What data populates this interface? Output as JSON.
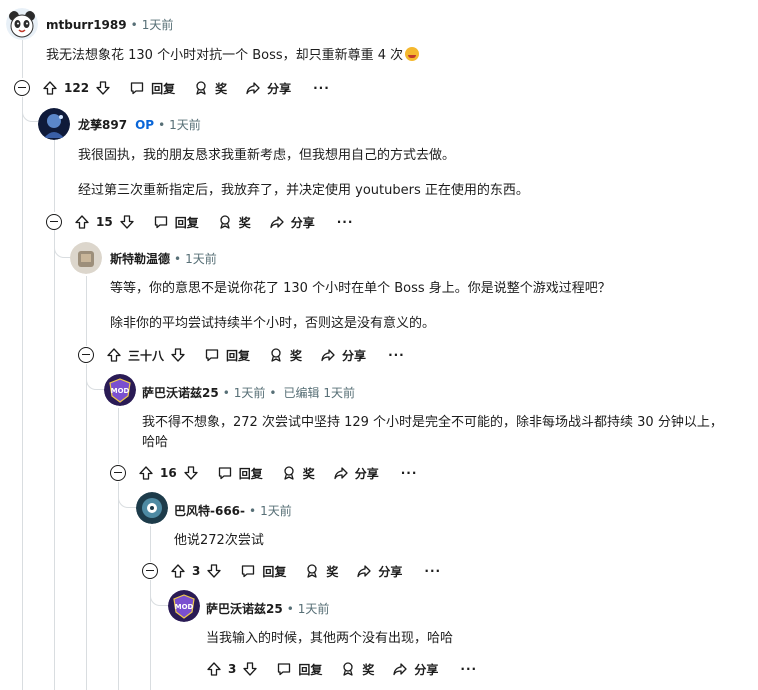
{
  "comments": [
    {
      "author": "mtburr1989",
      "op": "",
      "time": "1天前",
      "edited": "",
      "lines": [
        "我无法想象花 130 个小时对抗一个 Boss，却只重新尊重 4 次"
      ],
      "emoji": "rolling-on-floor-laughing",
      "score": "122"
    },
    {
      "author": "龙孳897",
      "op": "OP",
      "time": "1天前",
      "edited": "",
      "lines": [
        "我很固执，我的朋友恳求我重新考虑，但我想用自己的方式去做。",
        "经过第三次重新指定后，我放弃了，并决定使用 youtubers 正在使用的东西。"
      ],
      "score": "15"
    },
    {
      "author": "斯特勒温德",
      "op": "",
      "time": "1天前",
      "edited": "",
      "lines": [
        "等等，你的意思不是说你花了 130 个小时在单个 Boss 身上。你是说整个游戏过程吧？",
        "除非你的平均尝试持续半个小时，否则这是没有意义的。"
      ],
      "score": "三十八"
    },
    {
      "author": "萨巴沃诺兹25",
      "op": "",
      "time": "1天前",
      "edited": "已编辑 1天前",
      "lines": [
        "我不得不想象，272 次尝试中坚持 129 个小时是完全不可能的，除非每场战斗都持续 30 分钟以上，",
        "哈哈"
      ],
      "score": "16"
    },
    {
      "author": "巴风特-666-",
      "op": "",
      "time": "1天前",
      "edited": "",
      "lines": [
        "他说272次尝试"
      ],
      "score": "3"
    },
    {
      "author": "萨巴沃诺兹25",
      "op": "",
      "time": "1天前",
      "edited": "",
      "lines": [
        "当我输入的时候，其他两个没有出现，哈哈"
      ],
      "score": "3"
    }
  ],
  "actions": {
    "reply": "回复",
    "award": "奖",
    "share": "分享",
    "more": "···"
  },
  "separator": "•",
  "colors": {
    "text": "#1c1c1c",
    "meta": "#576f76",
    "op": "#0a66d8",
    "line": "#d9dde0"
  }
}
